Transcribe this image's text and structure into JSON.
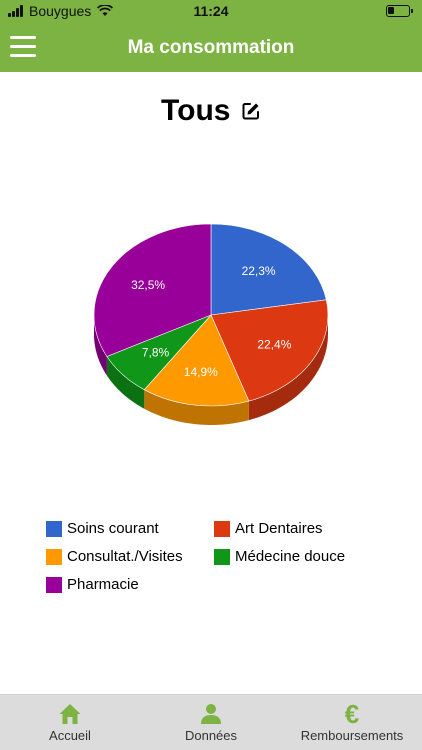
{
  "status_bar": {
    "carrier": "Bouygues",
    "time": "11:24",
    "battery_level": 0.3
  },
  "header": {
    "title": "Ma consommation"
  },
  "filter": {
    "title": "Tous"
  },
  "chart_data": {
    "type": "pie",
    "title": "Tous",
    "slices": [
      {
        "label": "Soins courant",
        "value": 22.3,
        "display": "22,3%",
        "color": "#3366cc"
      },
      {
        "label": "Art Dentaires",
        "value": 22.4,
        "display": "22,4%",
        "color": "#dc3912"
      },
      {
        "label": "Consultat./Visites",
        "value": 14.9,
        "display": "14,9%",
        "color": "#ff9900"
      },
      {
        "label": "Médecine douce",
        "value": 7.8,
        "display": "7,8%",
        "color": "#109618"
      },
      {
        "label": "Pharmacie",
        "value": 32.5,
        "display": "32,5%",
        "color": "#990099"
      }
    ],
    "legend_position": "bottom",
    "style": "3d"
  },
  "tabs": [
    {
      "label": "Accueil",
      "icon": "home-icon"
    },
    {
      "label": "Données",
      "icon": "user-icon"
    },
    {
      "label": "Remboursements",
      "icon": "euro-icon"
    }
  ],
  "colors": {
    "accent": "#7cb342",
    "tab_icon": "#7cb342",
    "tab_bar": "#dcdcdc"
  }
}
